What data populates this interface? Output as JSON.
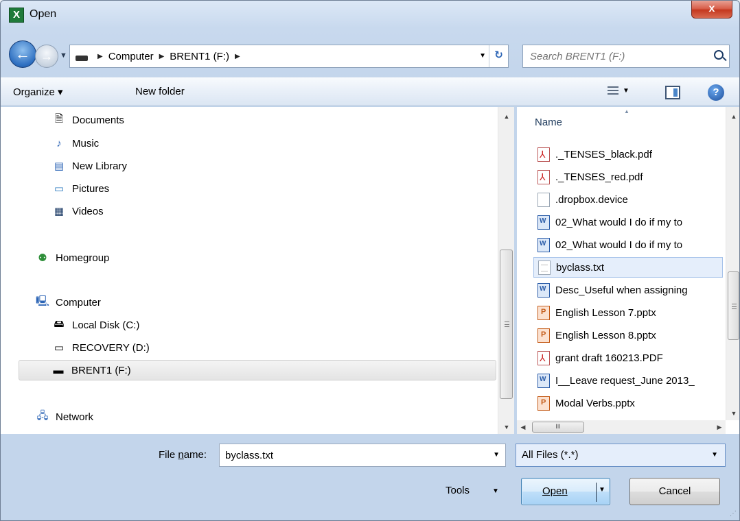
{
  "window": {
    "title": "Open",
    "app_icon": "excel-icon",
    "close_label": "x"
  },
  "address_bar": {
    "segments": [
      "Computer",
      "BRENT1 (F:)"
    ],
    "search_placeholder": "Search BRENT1 (F:)"
  },
  "toolbar": {
    "organize_label": "Organize ▾",
    "new_folder_label": "New folder"
  },
  "nav_pane": {
    "items": [
      {
        "label": "Documents",
        "icon": "documents-icon"
      },
      {
        "label": "Music",
        "icon": "music-icon"
      },
      {
        "label": "New Library",
        "icon": "library-icon"
      },
      {
        "label": "Pictures",
        "icon": "pictures-icon"
      },
      {
        "label": "Videos",
        "icon": "videos-icon"
      },
      {
        "label": "Homegroup",
        "icon": "homegroup-icon"
      },
      {
        "label": "Computer",
        "icon": "computer-icon"
      },
      {
        "label": "Local Disk (C:)",
        "icon": "local-disk-icon"
      },
      {
        "label": "RECOVERY (D:)",
        "icon": "drive-icon"
      },
      {
        "label": "BRENT1 (F:)",
        "icon": "usb-drive-icon",
        "selected": true
      },
      {
        "label": "Network",
        "icon": "network-icon"
      }
    ]
  },
  "file_list": {
    "column_header": "Name",
    "items": [
      {
        "name": "._TENSES_black.pdf",
        "type": "pdf"
      },
      {
        "name": "._TENSES_red.pdf",
        "type": "pdf"
      },
      {
        "name": ".dropbox.device",
        "type": "blank"
      },
      {
        "name": "02_What would I do if my to",
        "type": "doc"
      },
      {
        "name": "02_What would I do if my to",
        "type": "doc"
      },
      {
        "name": "byclass.txt",
        "type": "txt",
        "selected": true
      },
      {
        "name": "Desc_Useful when assigning",
        "type": "doc"
      },
      {
        "name": "English Lesson 7.pptx",
        "type": "ppt"
      },
      {
        "name": "English Lesson 8.pptx",
        "type": "ppt"
      },
      {
        "name": "grant draft 160213.PDF",
        "type": "pdf"
      },
      {
        "name": "I__Leave request_June 2013_",
        "type": "doc"
      },
      {
        "name": "Modal Verbs.pptx",
        "type": "ppt"
      }
    ],
    "hscroll_grip": "III"
  },
  "bottom": {
    "file_name_label_pre": "File ",
    "file_name_label_u": "n",
    "file_name_label_post": "ame:",
    "file_name_value": "byclass.txt",
    "filter_value": "All Files (*.*)",
    "tools_label": "Tools",
    "open_label": "Open",
    "cancel_label": "Cancel"
  }
}
